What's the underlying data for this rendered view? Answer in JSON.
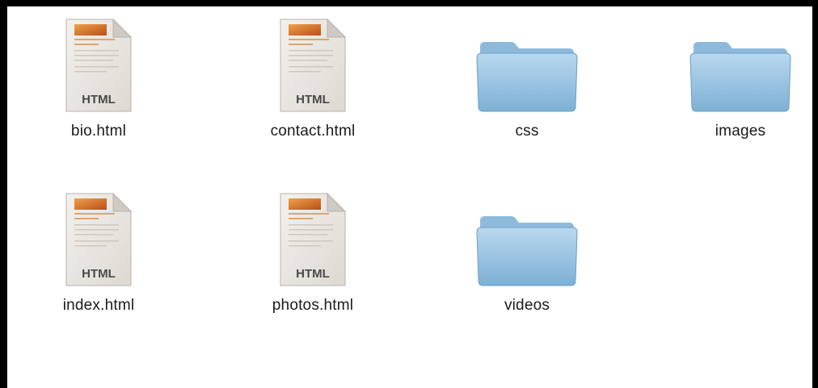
{
  "files": [
    {
      "name": "bio.html",
      "kind": "html-file-icon",
      "badge": "HTML"
    },
    {
      "name": "contact.html",
      "kind": "html-file-icon",
      "badge": "HTML"
    },
    {
      "name": "css",
      "kind": "folder-icon"
    },
    {
      "name": "images",
      "kind": "folder-icon"
    },
    {
      "name": "index.html",
      "kind": "html-file-icon",
      "badge": "HTML"
    },
    {
      "name": "photos.html",
      "kind": "html-file-icon",
      "badge": "HTML"
    },
    {
      "name": "videos",
      "kind": "folder-icon"
    }
  ],
  "colors": {
    "folder_light": "#a9cde6",
    "folder_dark": "#6fa7cf",
    "file_page": "#ebe7e3",
    "file_thumb": "#d9742a"
  }
}
